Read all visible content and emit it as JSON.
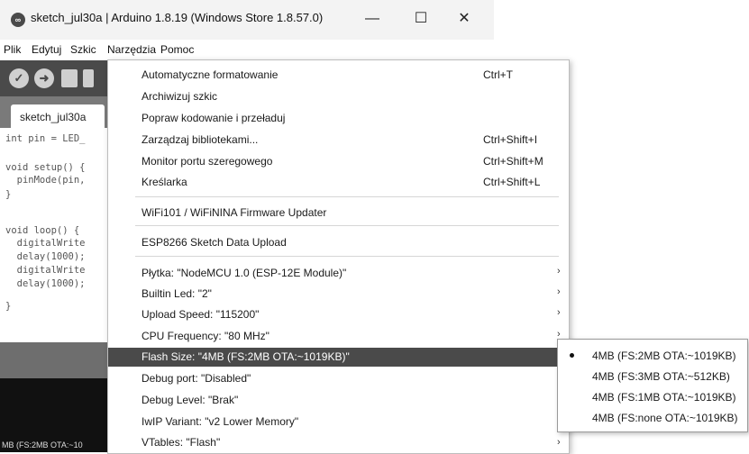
{
  "window": {
    "title": "sketch_jul30a | Arduino 1.8.19 (Windows Store 1.8.57.0)",
    "icon_text": "∞",
    "minimize": "—",
    "maximize": "☐",
    "close": "✕"
  },
  "menubar": {
    "items": [
      "Plik",
      "Edytuj",
      "Szkic",
      "Narzędzia",
      "Pomoc"
    ]
  },
  "toolbar": {
    "verify_icon": "✓",
    "upload_icon": "➜"
  },
  "tabs": [
    "sketch_jul30a"
  ],
  "editor": {
    "lines": [
      "int pin = LED_",
      "",
      "void setup() {",
      "  pinMode(pin,",
      "}",
      "",
      "void loop() {",
      "  digitalWrite",
      "  delay(1000);",
      "  digitalWrite",
      "  delay(1000);",
      "}"
    ]
  },
  "status": {
    "text": "MB (FS:2MB OTA:~10"
  },
  "tools_menu": {
    "items": [
      {
        "label": "Automatyczne formatowanie",
        "shortcut": "Ctrl+T"
      },
      {
        "label": "Archiwizuj szkic",
        "shortcut": ""
      },
      {
        "label": "Popraw kodowanie i przeładuj",
        "shortcut": ""
      },
      {
        "label": "Zarządzaj bibliotekami...",
        "shortcut": "Ctrl+Shift+I"
      },
      {
        "label": "Monitor portu szeregowego",
        "shortcut": "Ctrl+Shift+M"
      },
      {
        "label": "Kreślarka",
        "shortcut": "Ctrl+Shift+L"
      },
      {
        "label": "WiFi101 / WiFiNINA Firmware Updater",
        "shortcut": ""
      },
      {
        "label": "ESP8266 Sketch Data Upload",
        "shortcut": ""
      },
      {
        "label": "Płytka: \"NodeMCU 1.0 (ESP-12E Module)\"",
        "shortcut": ""
      },
      {
        "label": "Builtin Led: \"2\"",
        "shortcut": ""
      },
      {
        "label": "Upload Speed: \"115200\"",
        "shortcut": ""
      },
      {
        "label": "CPU Frequency: \"80 MHz\"",
        "shortcut": ""
      },
      {
        "label": "Flash Size: \"4MB (FS:2MB OTA:~1019KB)\"",
        "shortcut": ""
      },
      {
        "label": "Debug port: \"Disabled\"",
        "shortcut": ""
      },
      {
        "label": "Debug Level: \"Brak\"",
        "shortcut": ""
      },
      {
        "label": "IwIP Variant: \"v2 Lower Memory\"",
        "shortcut": ""
      },
      {
        "label": "VTables: \"Flash\"",
        "shortcut": ""
      }
    ],
    "submenu_arrow": "›",
    "highlighted_index": 12
  },
  "flash_submenu": {
    "options": [
      "4MB (FS:2MB OTA:~1019KB)",
      "4MB (FS:3MB OTA:~512KB)",
      "4MB (FS:1MB OTA:~1019KB)",
      "4MB (FS:none OTA:~1019KB)"
    ],
    "selected_index": 0
  },
  "colors": {
    "toolbar": "#4a4a4a",
    "highlight": "#4a4a4a",
    "console": "#111111"
  }
}
